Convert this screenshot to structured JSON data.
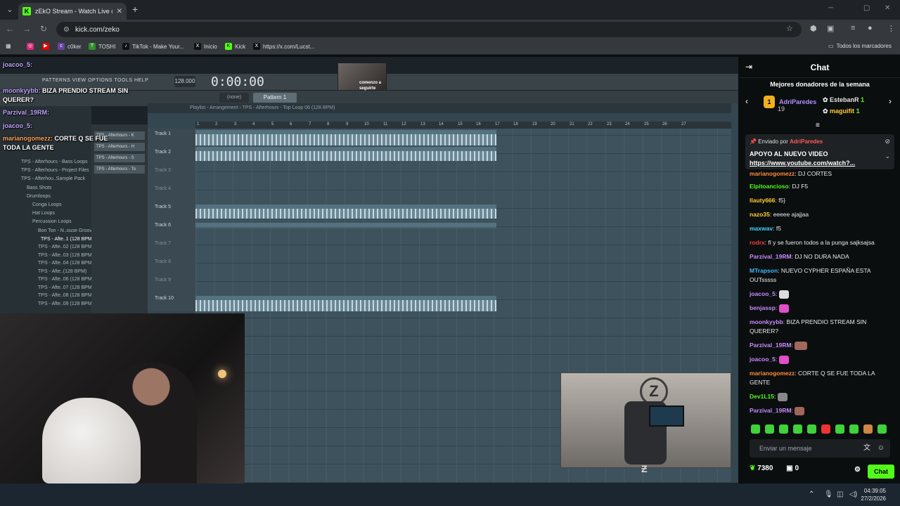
{
  "browser": {
    "tab_title": "zEkO Stream - Watch Live on Ki",
    "url": "kick.com/zeko",
    "bookmarks": [
      "c0ker",
      "TOSHI",
      "TikTok - Make Your...",
      "Inicio",
      "Kick",
      "https://x.com/Lucst..."
    ],
    "all_bookmarks": "Todos los marcadores"
  },
  "daw": {
    "menu": "PATTERNS  VIEW  OPTIONS  TOOLS  HELP",
    "bpm": "128.000",
    "time": "0:00:00",
    "pattern": "Pattern 1",
    "none": "(none)",
    "playlist_title": "Playlist - Arrangement  ›  TPS - Afterhours - Top Loop 06 (128 BPM)",
    "ruler": [
      "1",
      "2",
      "3",
      "4",
      "5",
      "6",
      "7",
      "8",
      "9",
      "10",
      "11",
      "12",
      "13",
      "14",
      "15",
      "16",
      "17",
      "18",
      "19",
      "20",
      "21",
      "22",
      "23",
      "24",
      "25",
      "26",
      "27"
    ],
    "tracks": [
      "Track 1",
      "Track 2",
      "Track 3",
      "Track 4",
      "Track 5",
      "Track 6",
      "Track 7",
      "Track 8",
      "Track 9",
      "Track 10"
    ],
    "browser_items": [
      "TPS - Afterhours - Bass Loops",
      "TPS - Afterhours - Project Files",
      "TPS - Afterhou..Sample Pack",
      "Bass Shots",
      "Drumloops",
      "Conga Loops",
      "Hat Loops",
      "Percussion Loops",
      "Bon Ton - N..ouse Groove",
      "TPS - Afte..1 (128 BPM)",
      "TPS - Afte..02 (128 BPM)",
      "TPS - Afte..03 (128 BPM)",
      "TPS - Afte..04 (128 BPM)",
      "TPS - Afte..(128 BPM)",
      "TPS - Afte..06 (128 BPM)",
      "TPS - Afte..07 (128 BPM)",
      "TPS - Afte..08 (128 BPM)",
      "TPS - Afte..09 (128 BPM)"
    ],
    "channels": [
      "TPS - Afterhours - K",
      "TPS - Afterhours - H",
      "TPS - Afterhours - S",
      "TPS - Afterhours - To"
    ],
    "cam_caption": "comenzo a seguirte"
  },
  "overlay_chat": [
    {
      "user": "joacoo_5:",
      "msg": ""
    },
    {
      "user": "moonkyybb:",
      "msg": "BIZA PRENDIO STREAM SIN"
    },
    {
      "user": "",
      "msg": "QUERER?"
    },
    {
      "user": "Parzival_19RM:",
      "msg": ""
    },
    {
      "user": "joacoo_5:",
      "msg": ""
    },
    {
      "user": "marianogomezz:",
      "msg": "CORTE Q SE FUE"
    },
    {
      "user": "",
      "msg": "TODA LA GENTE"
    }
  ],
  "chat": {
    "title": "Chat",
    "donors_title": "Mejores donadores de la semana",
    "donors": [
      {
        "rank": "1",
        "name": "AdriParedes",
        "amount": "19",
        "color": "#b48cff"
      },
      {
        "rank": "",
        "name": "EstebanR",
        "amount": "1",
        "color": "#ffffff"
      },
      {
        "rank": "",
        "name": "maguifit",
        "amount": "1",
        "color": "#ffcc33"
      }
    ],
    "pinned": {
      "sent_by": "Enviado por",
      "sender": "AdriParedes",
      "message": "APOYO AL NUEVO VIDEO",
      "link": "https://www.youtube.com/watch?..."
    },
    "messages": [
      {
        "user": "marianogomezz",
        "text": "DJ CORTES",
        "color": "#ff8a3d"
      },
      {
        "user": "Elpitoancioso",
        "text": "DJ F5",
        "color": "#53fc18"
      },
      {
        "user": "llauty666",
        "text": "f5}",
        "color": "#ffcc33"
      },
      {
        "user": "nazo35",
        "text": "eeeee ajajjaa",
        "color": "#ffcc33"
      },
      {
        "user": "maxwav",
        "text": "f5",
        "color": "#42d7ff"
      },
      {
        "user": "rodrx",
        "text": "fl y se fueron todos a la punga sajksajsa",
        "color": "#ff3b3b"
      },
      {
        "user": "Parzival_19RM",
        "text": "DJ NO DURA NADA",
        "color": "#c88bff"
      },
      {
        "user": "MTrapson",
        "text": "NUEVO CYPHER ESPAÑA ESTA OUTsssss",
        "color": "#42b4ff"
      },
      {
        "user": "joacoo_5",
        "text": "",
        "color": "#c88bff"
      },
      {
        "user": "benjassp",
        "text": "",
        "color": "#c88bff"
      },
      {
        "user": "moonkyybb",
        "text": "BIZA PRENDIO STREAM SIN QUERER?",
        "color": "#c88bff"
      },
      {
        "user": "Parzival_19RM",
        "text": "",
        "color": "#c88bff"
      },
      {
        "user": "joacoo_5",
        "text": "",
        "color": "#c88bff"
      },
      {
        "user": "marianogomezz",
        "text": "CORTE Q SE FUE TODA LA GENTE",
        "color": "#ff8a3d"
      },
      {
        "user": "Dev1L15",
        "text": "",
        "color": "#53fc18"
      },
      {
        "user": "Parzival_19RM",
        "text": "",
        "color": "#c88bff"
      }
    ],
    "input_placeholder": "Enviar un mensaje",
    "points": "7380",
    "points_icon": "leaf-icon",
    "gifts": "0",
    "send_label": "Chat"
  },
  "taskbar": {
    "time": "04:39:05",
    "date": "27/2/2026"
  }
}
